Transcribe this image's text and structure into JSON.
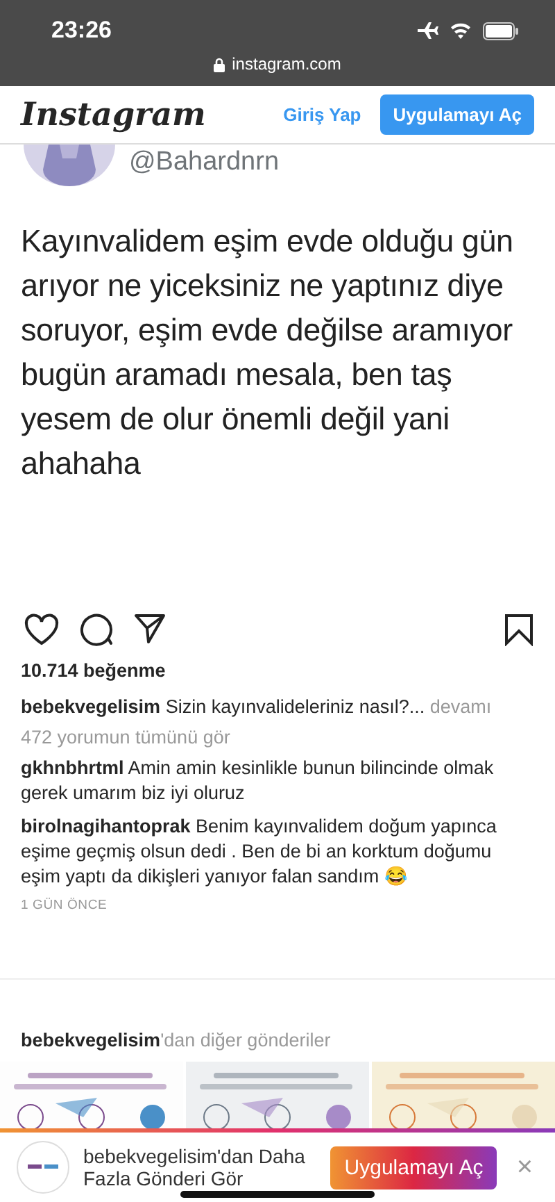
{
  "status_bar": {
    "time": "23:26",
    "url": "instagram.com"
  },
  "header": {
    "logo": "Instagram",
    "login": "Giriş Yap",
    "open_app": "Uygulamayı Aç"
  },
  "post_image": {
    "handle": "@Bahardnrn",
    "text": "Kayınvalidem eşim evde olduğu gün arıyor ne yiceksiniz ne yaptınız diye soruyor, eşim evde değilse aramıyor bugün aramadı mesala, ben taş yesem de olur önemli değil yani ahahaha"
  },
  "actions": {
    "saved": false
  },
  "likes": "10.714 beğenme",
  "caption": {
    "user": "bebekvegelisim",
    "text": "Sizin kayınvalideleriniz nasıl?...",
    "more": "devamı"
  },
  "view_comments": "472 yorumun tümünü gör",
  "comments": [
    {
      "user": "gkhnbhrtml",
      "text": "Amin amin kesinlikle bunun bilincinde olmak gerek umarım biz iyi oluruz"
    },
    {
      "user": "birolnagihantoprak",
      "text": "Benim kayınvalidem doğum yapınca eşime geçmiş olsun dedi . Ben de bi an korktum doğumu eşim yaptı da dikişleri yanıyor falan sandım 😂"
    }
  ],
  "time_ago": "1 GÜN ÖNCE",
  "more_posts": {
    "user": "bebekvegelisim",
    "suffix": "'dan diğer gönderiler"
  },
  "banner": {
    "text": "bebekvegelisim'dan Daha Fazla Gönderi Gör",
    "button": "Uygulamayı Aç",
    "close": "×"
  }
}
